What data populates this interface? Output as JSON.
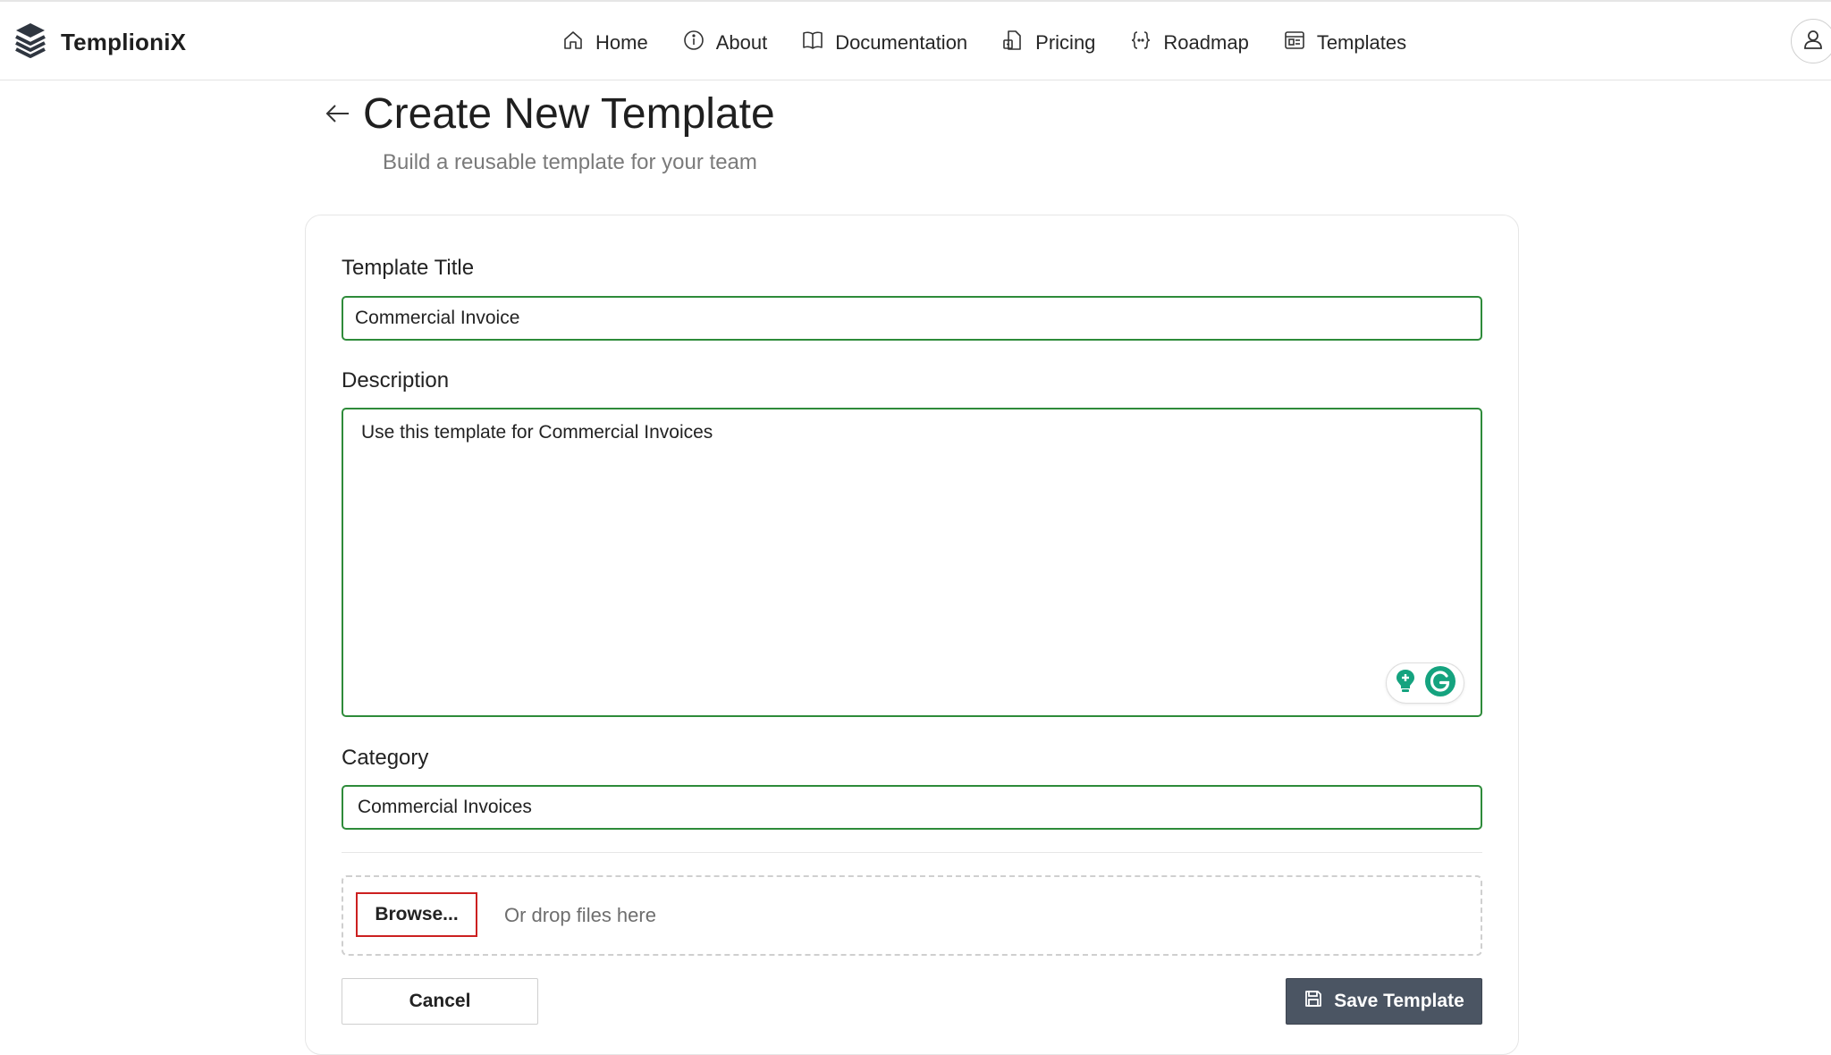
{
  "brand": {
    "name": "TemplioniX",
    "icon": "stacked-layers-logo"
  },
  "nav": {
    "items": [
      {
        "label": "Home",
        "icon": "home-icon"
      },
      {
        "label": "About",
        "icon": "info-icon"
      },
      {
        "label": "Documentation",
        "icon": "book-icon"
      },
      {
        "label": "Pricing",
        "icon": "price-tag-icon"
      },
      {
        "label": "Roadmap",
        "icon": "braces-icon"
      },
      {
        "label": "Templates",
        "icon": "template-icon"
      }
    ],
    "account_icon": "user-icon"
  },
  "header": {
    "title": "Create New Template",
    "subtitle": "Build a reusable template for your team"
  },
  "form": {
    "title_label": "Template Title",
    "title_value": "Commercial Invoice",
    "description_label": "Description",
    "description_value": "Use this template for Commercial Invoices",
    "category_label": "Category",
    "category_value": "Commercial Invoices",
    "browse_label": "Browse...",
    "drop_hint": "Or drop files here",
    "cancel_label": "Cancel",
    "save_label": "Save Template"
  },
  "colors": {
    "field_border": "#2e8b3a",
    "browse_border": "#cc2020",
    "save_button_bg": "#4b5563",
    "grammarly_green": "#15a37f"
  }
}
